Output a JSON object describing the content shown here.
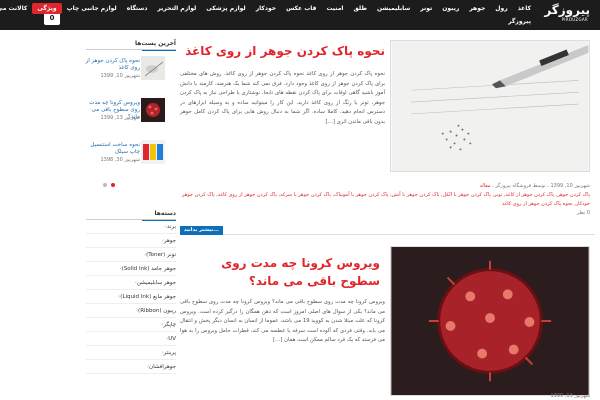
{
  "nav": {
    "cart_count": "0",
    "row1": [
      "کاغذ",
      "رول",
      "جوهر",
      "ریبون",
      "تونر",
      "سابلیمیشن",
      "طلق",
      "امنیت",
      "قاب عکس",
      "خودکار",
      "لوازم پزشکی",
      "لوازم التحریر",
      "دستگاه",
      "لوازم جانبی چاپ",
      "ویژگی"
    ],
    "row2": [
      "پیروزگر"
    ],
    "extra": "کالانت می"
  },
  "logo": {
    "fa": "پیروزگر",
    "en": "PIROUZGAR"
  },
  "sidebar": {
    "recent_title": "آخرین پست‌ها",
    "recent_posts": [
      {
        "title": "نحوه پاک کردن جوهر از روی کاغذ",
        "date": "شهریور 10, 1399"
      },
      {
        "title": "ویروس کرونا چه مدت روی سطوح باقی می ماند؟",
        "date": "شهریور 13, 1399"
      },
      {
        "title": "نحوه ساخت استنسیل چاپ سیلک",
        "date": "شهریور 30, 1398"
      }
    ],
    "categories_title": "دسته‌ها",
    "categories": [
      "برند",
      "جوهر",
      "تونر (Toner)",
      "جوهر جامد (Solid Ink)",
      "جوهر سابلیمیشن",
      "جوهر مایع (Liquid Ink)",
      "ریبون (Ribbon)",
      "چاپگر",
      "UV",
      "پرینتر",
      "جوهرافشان"
    ]
  },
  "posts": [
    {
      "title": "نحوه پاک کردن جوهر از روی کاغذ",
      "excerpt": "نحوه پاک کردن جوهر از روی کاغذ نحوه پاک کردن جوهر از روی کاغذ. روش های مختلفی برای پاک کردن جوهر از روی کاغذ وجود دارد. فرق نمی کند شما یک هنرمند، کارمند یا دانش آموز باشید گاهی اوقات برای پاک کردن نقطه های نابجا، نوشتاری یا طراحی نیاز به پاک کردن جوهر، تونر یا رنگ از روی کاغذ دارید. این کار را میتوانید ساده و به وسیله ابزارهای در دسترس انجام دهید. کاملا ساده. اگر شما به دنبال روش هایی برای پاک کردن کامل جوهر بدون باقی ماندن اثری […]",
      "date": "شهریور 10, 1399",
      "author": "توسط فروشگاه پیروزگر",
      "category": "مقاله",
      "tags": "پاک کردن جوهر, پاک کردن جوهر از کاغذ, تونر, پاک کردن جوهر با الکل, پاک کردن جوهر با آتش, پاک کردن جوهر با آمونیاک, پاک کردن جوهر با سرکه, پاک کردن جوهر از روی کاغذ, پاک کردن جوهر خودکار, نحوه پاک کردن جوهر از روی کاغذ",
      "comments": "0 نظر",
      "readmore": "بیشتر بدانید..."
    },
    {
      "title": "ویروس کرونا چه مدت روی سطوح باقی می ماند؟",
      "excerpt": "ویروس کرونا چه مدت روی سطوح باقی می ماند؟ ویروس کرونا چه مدت روی سطوح باقی می ماند؟ یکی از سوال های اصلی امروز است که ذهن همگان را درگیر کرده است. ویروس کرونا که علت مبتلا شدن به کووید 19 می باشد، عموما از انسان به انسان دیگر پخش و انتقال می یابد. وقتی فردی که آلوده است سرفه یا عطسه می کند، قطرات حامل ویروس را به هوا می فرستد که یک فرد سالم ممکن است همان […]",
      "date": "شهریور 13, 1399"
    }
  ],
  "colors": {
    "accent": "#e0262c",
    "link": "#0c6fb8",
    "nav_bg": "#1c1c1c"
  }
}
